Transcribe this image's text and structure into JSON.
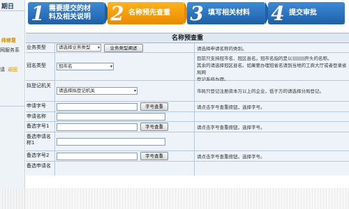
{
  "sidebar": {
    "title": "期日",
    "link_a": "纬修复",
    "link_b": "网服务系",
    "link_c": "请",
    "link_d": "返回"
  },
  "steps": [
    {
      "num": "1",
      "label_line1": "需要提交的材",
      "label_line2": "料及相关说明"
    },
    {
      "num": "2",
      "label_line1": "名称预先查重",
      "label_line2": ""
    },
    {
      "num": "3",
      "label_line1": "填写相关材料",
      "label_line2": ""
    },
    {
      "num": "4",
      "label_line1": "提交审批",
      "label_line2": ""
    }
  ],
  "form": {
    "title": "名称预查重",
    "rows": {
      "business_type": {
        "label": "业务类型",
        "select_value": "请选择业务类型",
        "button": "业务类型阐述",
        "note": "请选择申请名称的类别。"
      },
      "crown_name": {
        "label": "冠名类型",
        "select_value": "冠市名",
        "note_1": "目前只支持冠市名、冠区县名。冠市名指的是以",
        "note_1b": "开头的名称。",
        "note_2": "其余的请选择冠区县名。如果要办理冠省名请到当地的工商大厅或者登录省局网",
        "note_3": "登记系统办理。"
      },
      "authority": {
        "label": "拟登记机关",
        "select_value": "请选择拟登记机关",
        "note": "市局只登记注册资本万以上的企业，低于万的请选择分局登记。"
      },
      "name_code": {
        "label": "申请字号",
        "button": "字号查重",
        "note": "请点击字号查重按钮，选择字号。"
      },
      "apply_name": {
        "label": "申请名称"
      },
      "alt_code_1": {
        "label": "备选字号1",
        "button": "字号查重",
        "note": "请点击字号查重按钮，选择字号。"
      },
      "alt_name_1": {
        "label": "备选申请名称1"
      },
      "alt_code_2": {
        "label": "备选字号2",
        "button": "字号查重",
        "note": "请点击字号查重按钮，选择字号。"
      },
      "alt_name_2": {
        "label": "备选申请名"
      }
    }
  },
  "colors": {
    "step_blue": "#1e5fa8",
    "step_orange": "#e88a00",
    "form_bg": "#edf3f9"
  }
}
